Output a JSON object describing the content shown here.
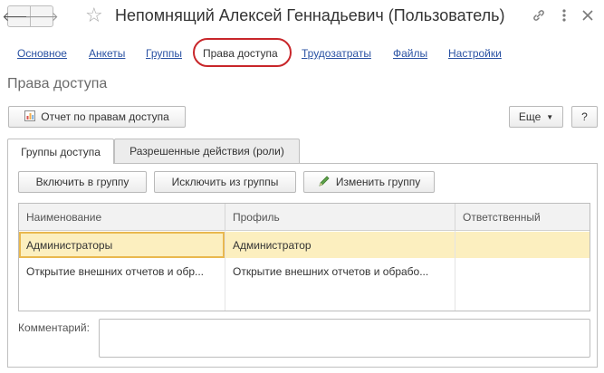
{
  "window": {
    "title": "Непомнящий Алексей Геннадьевич (Пользователь)",
    "back_icon": "arrow-left-icon",
    "forward_icon": "arrow-right-icon",
    "favorite_icon": "star-icon",
    "link_icon": "link-icon",
    "menu_icon": "more-vertical-icon",
    "close_icon": "close-icon"
  },
  "sections": [
    {
      "label": "Основное"
    },
    {
      "label": "Анкеты"
    },
    {
      "label": "Группы"
    },
    {
      "label": "Права доступа",
      "active": true
    },
    {
      "label": "Трудозатраты"
    },
    {
      "label": "Файлы"
    },
    {
      "label": "Настройки"
    }
  ],
  "page": {
    "title": "Права доступа",
    "report_button": "Отчет по правам доступа",
    "more_button": "Еще",
    "help_button": "?"
  },
  "tabs": [
    {
      "label": "Группы доступа",
      "active": true
    },
    {
      "label": "Разрешенные действия (роли)",
      "active": false
    }
  ],
  "toolbar": {
    "include": "Включить в группу",
    "exclude": "Исключить из группы",
    "change": "Изменить группу"
  },
  "table": {
    "columns": [
      "Наименование",
      "Профиль",
      "Ответственный"
    ],
    "rows": [
      {
        "name": "Администраторы",
        "profile": "Администратор",
        "responsible": "",
        "selected": true
      },
      {
        "name": "Открытие внешних отчетов и обр...",
        "profile": "Открытие внешних отчетов и обрабо...",
        "responsible": "",
        "selected": false
      }
    ]
  },
  "comment": {
    "label": "Комментарий:",
    "value": ""
  },
  "colors": {
    "link": "#2a52a3",
    "highlight_ring": "#c8262a",
    "selected_row": "#fcefbf",
    "focus_cell": "#e9b84e"
  }
}
